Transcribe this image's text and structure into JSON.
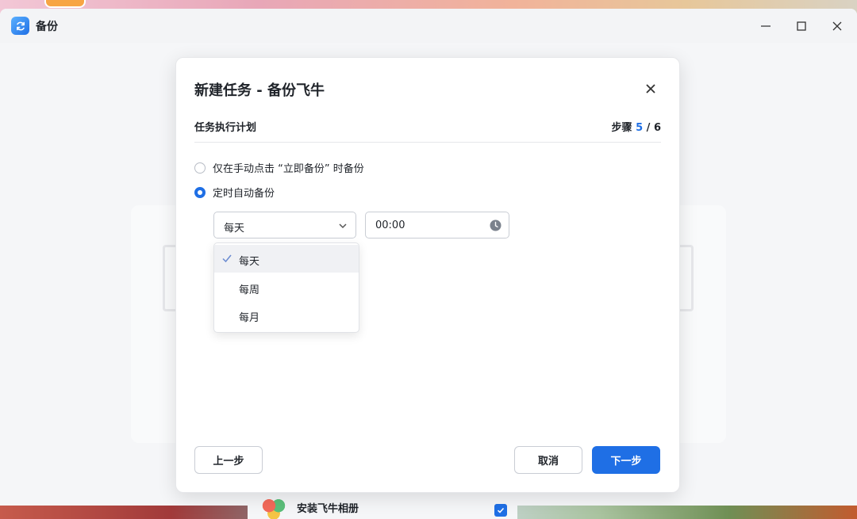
{
  "window": {
    "title": "备份",
    "controls": [
      "minimize",
      "maximize",
      "close"
    ]
  },
  "dialog": {
    "title": "新建任务 - 备份飞牛",
    "section_label": "任务执行计划",
    "step_prefix": "步骤",
    "step_current": "5",
    "step_separator": "/",
    "step_total": "6",
    "options": [
      {
        "label": "仅在手动点击 “立即备份” 时备份",
        "selected": false
      },
      {
        "label": "定时自动备份",
        "selected": true
      }
    ],
    "frequency_select": {
      "value": "每天"
    },
    "time_input": {
      "value": "00:00"
    },
    "frequency_options": [
      {
        "label": "每天",
        "selected": true
      },
      {
        "label": "每周",
        "selected": false
      },
      {
        "label": "每月",
        "selected": false
      }
    ],
    "buttons": {
      "prev": "上一步",
      "cancel": "取消",
      "next": "下一步"
    }
  },
  "background": {
    "install_label": "安装飞牛相册",
    "install_checked": true
  },
  "colors": {
    "accent": "#1f6fe5"
  }
}
